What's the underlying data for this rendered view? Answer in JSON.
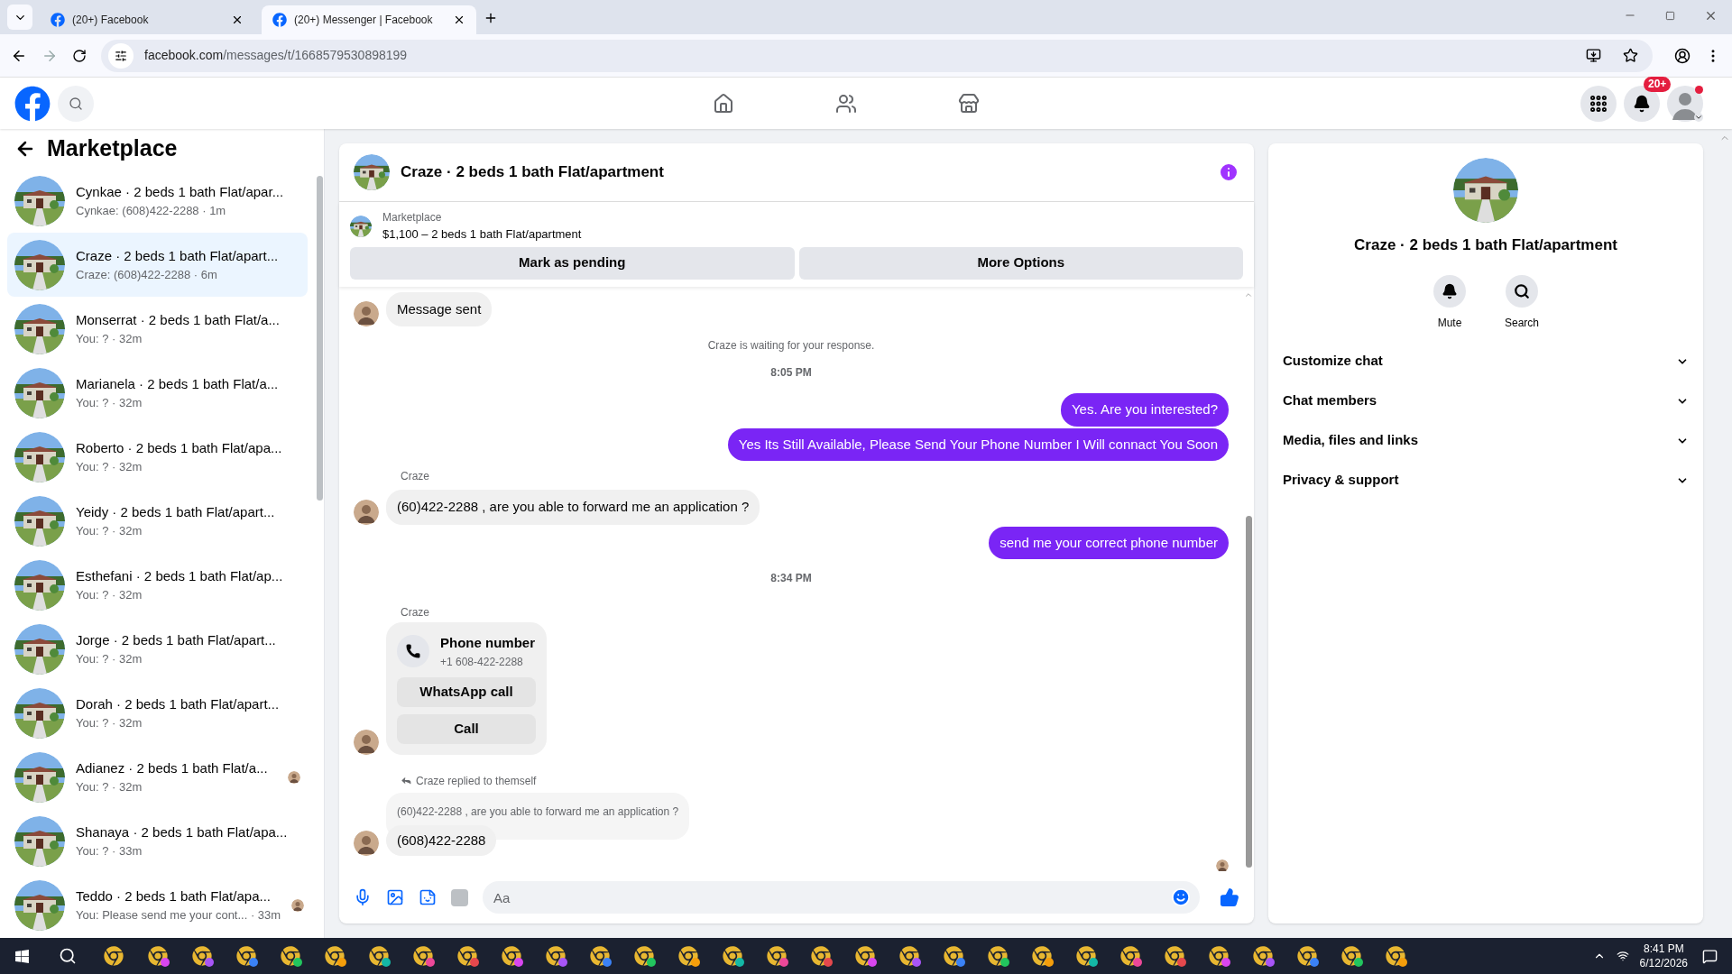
{
  "browser": {
    "tabs": [
      {
        "title": "(20+) Facebook",
        "selected": false
      },
      {
        "title": "(20+) Messenger | Facebook",
        "selected": true
      }
    ],
    "url_host": "facebook.com",
    "url_path": "/messages/t/1668579530898199"
  },
  "topnav": {
    "notifications_badge": "20+",
    "profile_dot": true
  },
  "sidebar": {
    "title": "Marketplace",
    "items": [
      {
        "title": "Cynkae · 2 beds 1 bath Flat/apar...",
        "subtitle": "Cynkae: (608)422-2288 · 1m",
        "selected": false,
        "read_receipt": false
      },
      {
        "title": "Craze · 2 beds 1 bath Flat/apart...",
        "subtitle": "Craze: (608)422-2288 · 6m",
        "selected": true,
        "read_receipt": false
      },
      {
        "title": "Monserrat · 2 beds 1 bath Flat/a...",
        "subtitle": "You: ? · 32m",
        "selected": false,
        "read_receipt": false
      },
      {
        "title": "Marianela · 2 beds 1 bath Flat/a...",
        "subtitle": "You: ? · 32m",
        "selected": false,
        "read_receipt": false
      },
      {
        "title": "Roberto · 2 beds 1 bath Flat/apa...",
        "subtitle": "You: ? · 32m",
        "selected": false,
        "read_receipt": false
      },
      {
        "title": "Yeidy · 2 beds 1 bath Flat/apart...",
        "subtitle": "You: ? · 32m",
        "selected": false,
        "read_receipt": false
      },
      {
        "title": "Esthefani · 2 beds 1 bath Flat/ap...",
        "subtitle": "You: ? · 32m",
        "selected": false,
        "read_receipt": false
      },
      {
        "title": "Jorge · 2 beds 1 bath Flat/apart...",
        "subtitle": "You: ? · 32m",
        "selected": false,
        "read_receipt": false
      },
      {
        "title": "Dorah · 2 beds 1 bath Flat/apart...",
        "subtitle": "You: ? · 32m",
        "selected": false,
        "read_receipt": false
      },
      {
        "title": "Adianez · 2 beds 1 bath Flat/a...",
        "subtitle": "You: ? · 32m",
        "selected": false,
        "read_receipt": true
      },
      {
        "title": "Shanaya · 2 beds 1 bath Flat/apa...",
        "subtitle": "You: ? · 33m",
        "selected": false,
        "read_receipt": false
      },
      {
        "title": "Teddo · 2 beds 1 bath Flat/apa...",
        "subtitle": "You: Please send me your cont... · 33m",
        "selected": false,
        "read_receipt": true
      }
    ]
  },
  "chat": {
    "title": "Craze · 2 beds 1 bath Flat/apartment",
    "listing": {
      "label": "Marketplace",
      "price_title": "$1,100 – 2 beds 1 bath Flat/apartment",
      "buttons": [
        "Mark as pending",
        "More Options"
      ]
    },
    "messages": [
      {
        "kind": "incoming",
        "text": "Message sent"
      },
      {
        "kind": "notice",
        "text": "Craze is waiting for your response."
      },
      {
        "kind": "time",
        "text": "8:05 PM"
      },
      {
        "kind": "outgoing",
        "text": "Yes. Are you interested?"
      },
      {
        "kind": "outgoing",
        "text": "Yes Its Still Available, Please Send Your Phone Number I Will connact You Soon"
      },
      {
        "kind": "sender",
        "text": "Craze"
      },
      {
        "kind": "incoming",
        "text": "(60)422-2288 , are you able to forward me an application ?"
      },
      {
        "kind": "outgoing",
        "text": "send me your correct phone number"
      },
      {
        "kind": "time",
        "text": "8:34 PM"
      },
      {
        "kind": "sender",
        "text": "Craze"
      },
      {
        "kind": "contact",
        "title": "Phone number",
        "number": "+1 608-422-2288",
        "buttons": [
          "WhatsApp call",
          "Call"
        ]
      },
      {
        "kind": "reply",
        "label": "Craze replied to themself",
        "quoted": "(60)422-2288 , are you able to forward me an application ?",
        "text": "(608)422-2288"
      }
    ],
    "composer": {
      "placeholder": "Aa"
    }
  },
  "details": {
    "title": "Craze · 2 beds 1 bath Flat/apartment",
    "actions": [
      "Mute",
      "Search"
    ],
    "sections": [
      {
        "label": "Customize chat",
        "expanded": false
      },
      {
        "label": "Chat members",
        "expanded": false
      },
      {
        "label": "Media, files and links",
        "expanded": false
      },
      {
        "label": "Privacy & support",
        "expanded": false
      }
    ]
  },
  "taskbar": {
    "time": "8:41 PM",
    "date": "6/12/2026"
  }
}
